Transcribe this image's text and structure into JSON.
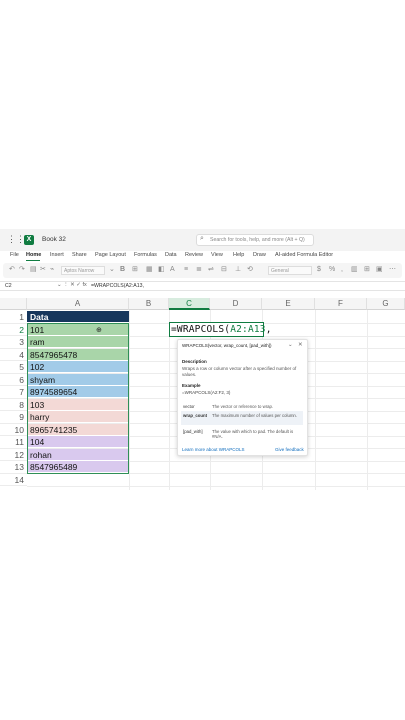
{
  "titlebar": {
    "doc_name": "Book 32",
    "app_letter": "X",
    "search_placeholder": "Search for tools, help, and more (Alt + Q)"
  },
  "menu": [
    "File",
    "Home",
    "Insert",
    "Share",
    "Page Layout",
    "Formulas",
    "Data",
    "Review",
    "View",
    "Help",
    "Draw",
    "AI-aided Formula Editor"
  ],
  "ribbon": {
    "font_name": "Aptos Narrow",
    "number_format": "General",
    "icons": [
      "undo-icon",
      "redo-icon",
      "paste-icon",
      "clipboard-icon",
      "format-painter-icon",
      "bold-icon",
      "borders-icon",
      "fill-color-icon",
      "font-color-icon",
      "align-left-icon",
      "align-center-icon",
      "wrap-text-icon",
      "merge-icon",
      "currency-icon",
      "percent-icon",
      "conditional-format-icon",
      "table-icon",
      "cell-styles-icon",
      "more-icon"
    ]
  },
  "formula_bar": {
    "name_box": "C2",
    "icons": "⌄  ⋮  ✕  ✓  fx",
    "formula": "=WRAPCOLS(A2:A13,"
  },
  "sheet": {
    "columns": [
      "A",
      "B",
      "C",
      "D",
      "E",
      "F",
      "G"
    ],
    "rows": [
      "1",
      "2",
      "3",
      "4",
      "5",
      "6",
      "7",
      "8",
      "9",
      "10",
      "11",
      "12",
      "13",
      "14"
    ],
    "column_a": [
      "Data",
      "101",
      "ram",
      "8547965478",
      "102",
      "shyam",
      "8974589654",
      "103",
      "harry",
      "8965741235",
      "104",
      "rohan",
      "8547965489"
    ],
    "row_colors": [
      "#16365c",
      "#a9d5a9",
      "#a9d5a9",
      "#a9d5a9",
      "#a2cbe8",
      "#a2cbe8",
      "#a2cbe8",
      "#f3d9d6",
      "#f3d9d6",
      "#f3d9d6",
      "#d9c9ee",
      "#d9c9ee",
      "#d9c9ee"
    ],
    "active_cell_prefix": "=WRAPCOLS(",
    "active_cell_ref": "A2:A13",
    "active_cell_suffix": ","
  },
  "tooltip": {
    "signature": "WRAPCOLS(vector, wrap_count, [pad_with])",
    "description_heading": "Description",
    "description": "Wraps a row or column vector after a specified number of values.",
    "example_heading": "Example",
    "example": "=WRAPCOLS(A2:F2, 3)",
    "args": [
      {
        "name": "vector",
        "desc": "The vector or reference to wrap."
      },
      {
        "name": "wrap_count",
        "desc": "The maximum number of values per column."
      },
      {
        "name": "[pad_with]",
        "desc": "The value with which to pad. The default is #N/A."
      }
    ],
    "learn_more": "Learn more about WRAPCOLS",
    "feedback": "Give feedback"
  },
  "colors": {
    "excel_green": "#107c41",
    "header_fill": "#16365c",
    "link_blue": "#0f6cbd"
  }
}
